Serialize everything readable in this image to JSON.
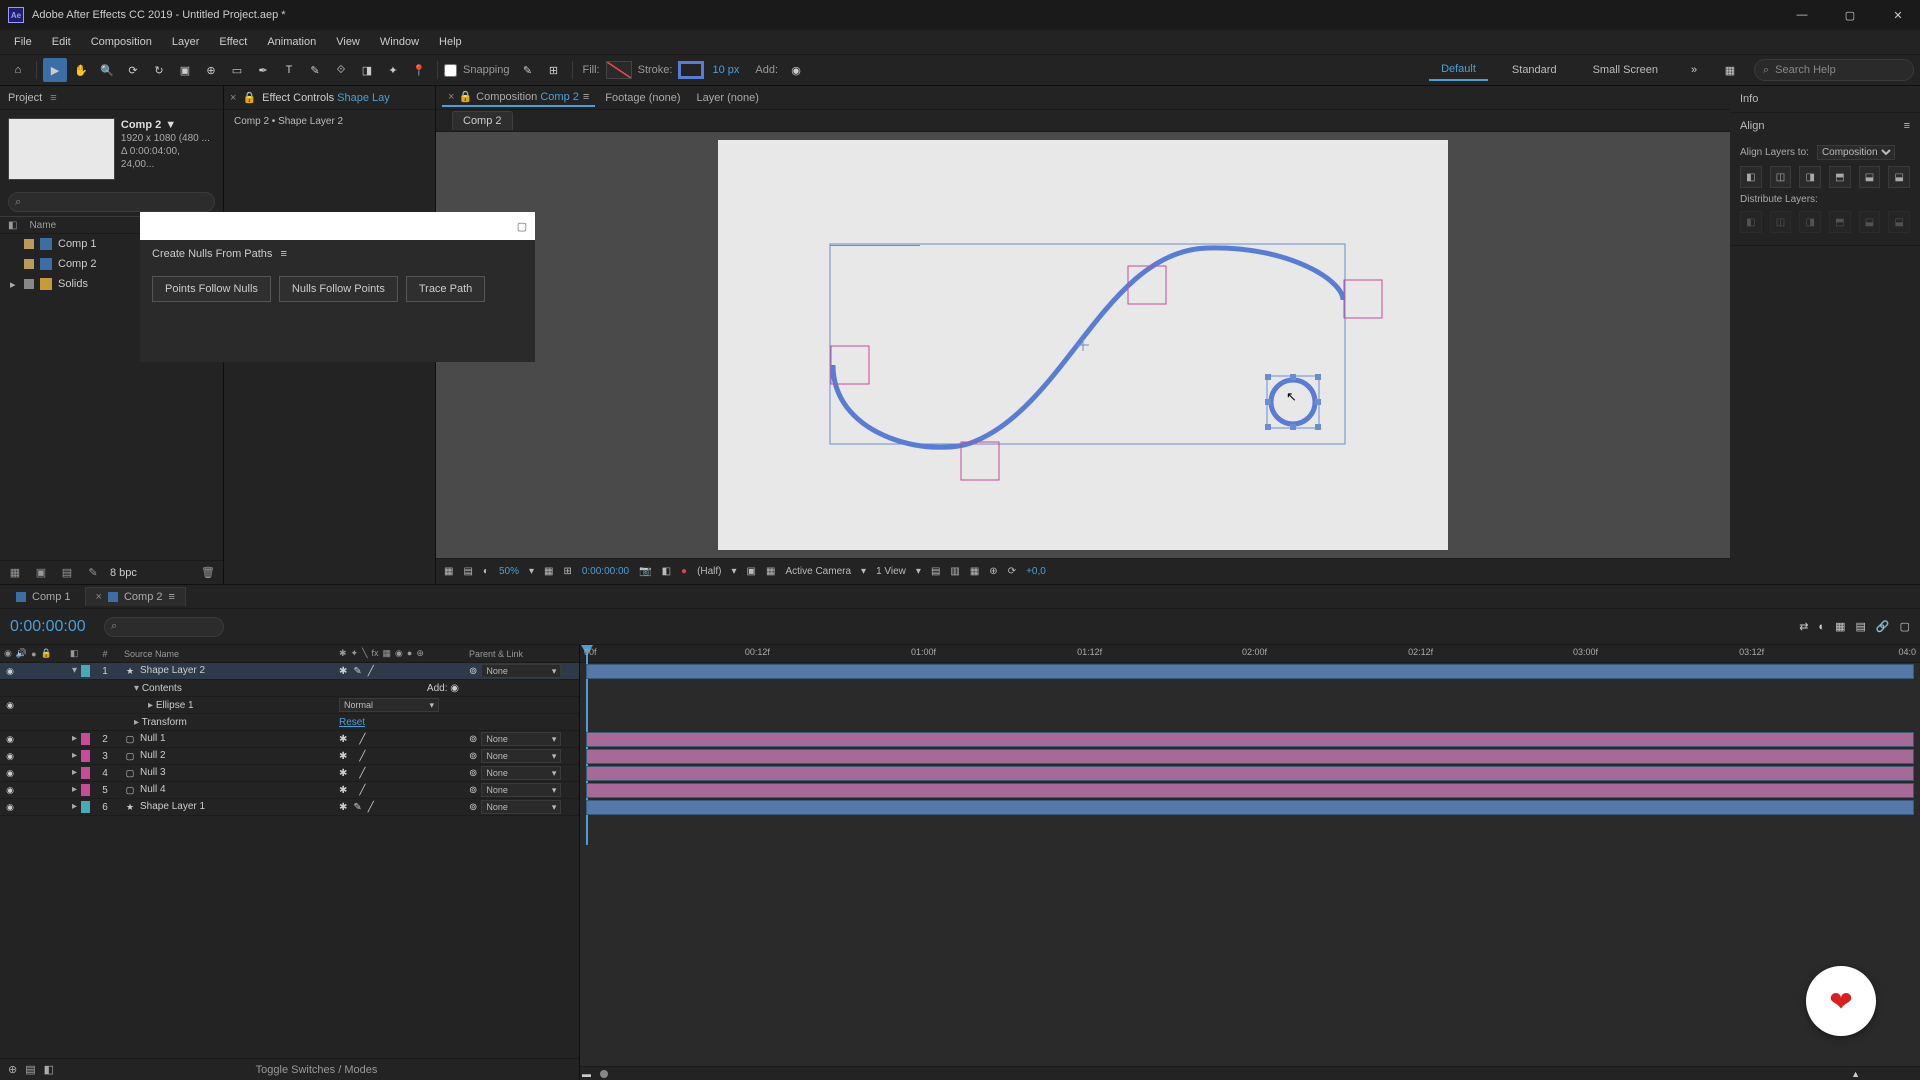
{
  "window": {
    "title": "Adobe After Effects CC 2019 - Untitled Project.aep *"
  },
  "menu": {
    "items": [
      "File",
      "Edit",
      "Composition",
      "Layer",
      "Effect",
      "Animation",
      "View",
      "Window",
      "Help"
    ]
  },
  "toolbar": {
    "snapping_label": "Snapping",
    "fill_label": "Fill:",
    "stroke_label": "Stroke:",
    "stroke_px": "10 px",
    "add_label": "Add:",
    "workspaces": [
      "Default",
      "Standard",
      "Small Screen"
    ],
    "search_placeholder": "Search Help"
  },
  "project": {
    "panel_title": "Project",
    "comp_name": "Comp 2",
    "comp_meta1": "1920 x 1080 (480 ...",
    "comp_meta2": "Δ 0:00:04:00, 24,00...",
    "name_col": "Name",
    "items": [
      {
        "label": "Comp 1",
        "type": "comp"
      },
      {
        "label": "Comp 2",
        "type": "comp"
      },
      {
        "label": "Solids",
        "type": "folder"
      }
    ],
    "bpc": "8 bpc"
  },
  "effect_controls": {
    "tab_prefix": "Effect Controls",
    "tab_target": "Shape Lay",
    "breadcrumb": "Comp 2 • Shape Layer 2"
  },
  "nulls_panel": {
    "title": "Create Nulls From Paths",
    "btn1": "Points Follow Nulls",
    "btn2": "Nulls Follow Points",
    "btn3": "Trace Path"
  },
  "comp_panel": {
    "tab_prefix": "Composition",
    "tab_name": "Comp 2",
    "footage_tab": "Footage   (none)",
    "layer_tab": "Layer   (none)",
    "subtab": "Comp 2",
    "zoom": "50%",
    "timecode": "0:00:00:00",
    "res": "(Half)",
    "camera": "Active Camera",
    "view": "1 View",
    "offset": "+0,0"
  },
  "right": {
    "info_title": "Info",
    "align_title": "Align",
    "align_layers_to": "Align Layers to:",
    "align_target": "Composition",
    "distribute": "Distribute Layers:"
  },
  "timeline": {
    "tab1": "Comp 1",
    "tab2": "Comp 2",
    "timecode": "0:00:00:00",
    "layer_header": {
      "num": "#",
      "name": "Source Name",
      "parent": "Parent & Link"
    },
    "ruler": [
      "00f",
      "00:12f",
      "01:00f",
      "01:12f",
      "02:00f",
      "02:12f",
      "03:00f",
      "03:12f",
      "04:0"
    ],
    "layers": [
      {
        "num": "1",
        "name": "Shape Layer 2",
        "color": "cyan",
        "icon": "star",
        "parent": "None",
        "selected": true
      },
      {
        "num": "",
        "name": "Contents",
        "indent": 1,
        "add": "Add:"
      },
      {
        "num": "",
        "name": "Ellipse 1",
        "indent": 2,
        "mode": "Normal"
      },
      {
        "num": "",
        "name": "Transform",
        "indent": 1,
        "reset": "Reset"
      },
      {
        "num": "2",
        "name": "Null 1",
        "color": "mag",
        "icon": "box",
        "parent": "None"
      },
      {
        "num": "3",
        "name": "Null 2",
        "color": "mag",
        "icon": "box",
        "parent": "None"
      },
      {
        "num": "4",
        "name": "Null 3",
        "color": "mag",
        "icon": "box",
        "parent": "None"
      },
      {
        "num": "5",
        "name": "Null 4",
        "color": "mag",
        "icon": "box",
        "parent": "None"
      },
      {
        "num": "6",
        "name": "Shape Layer 1",
        "color": "cyan",
        "icon": "star",
        "parent": "None"
      }
    ],
    "toggle": "Toggle Switches / Modes"
  }
}
